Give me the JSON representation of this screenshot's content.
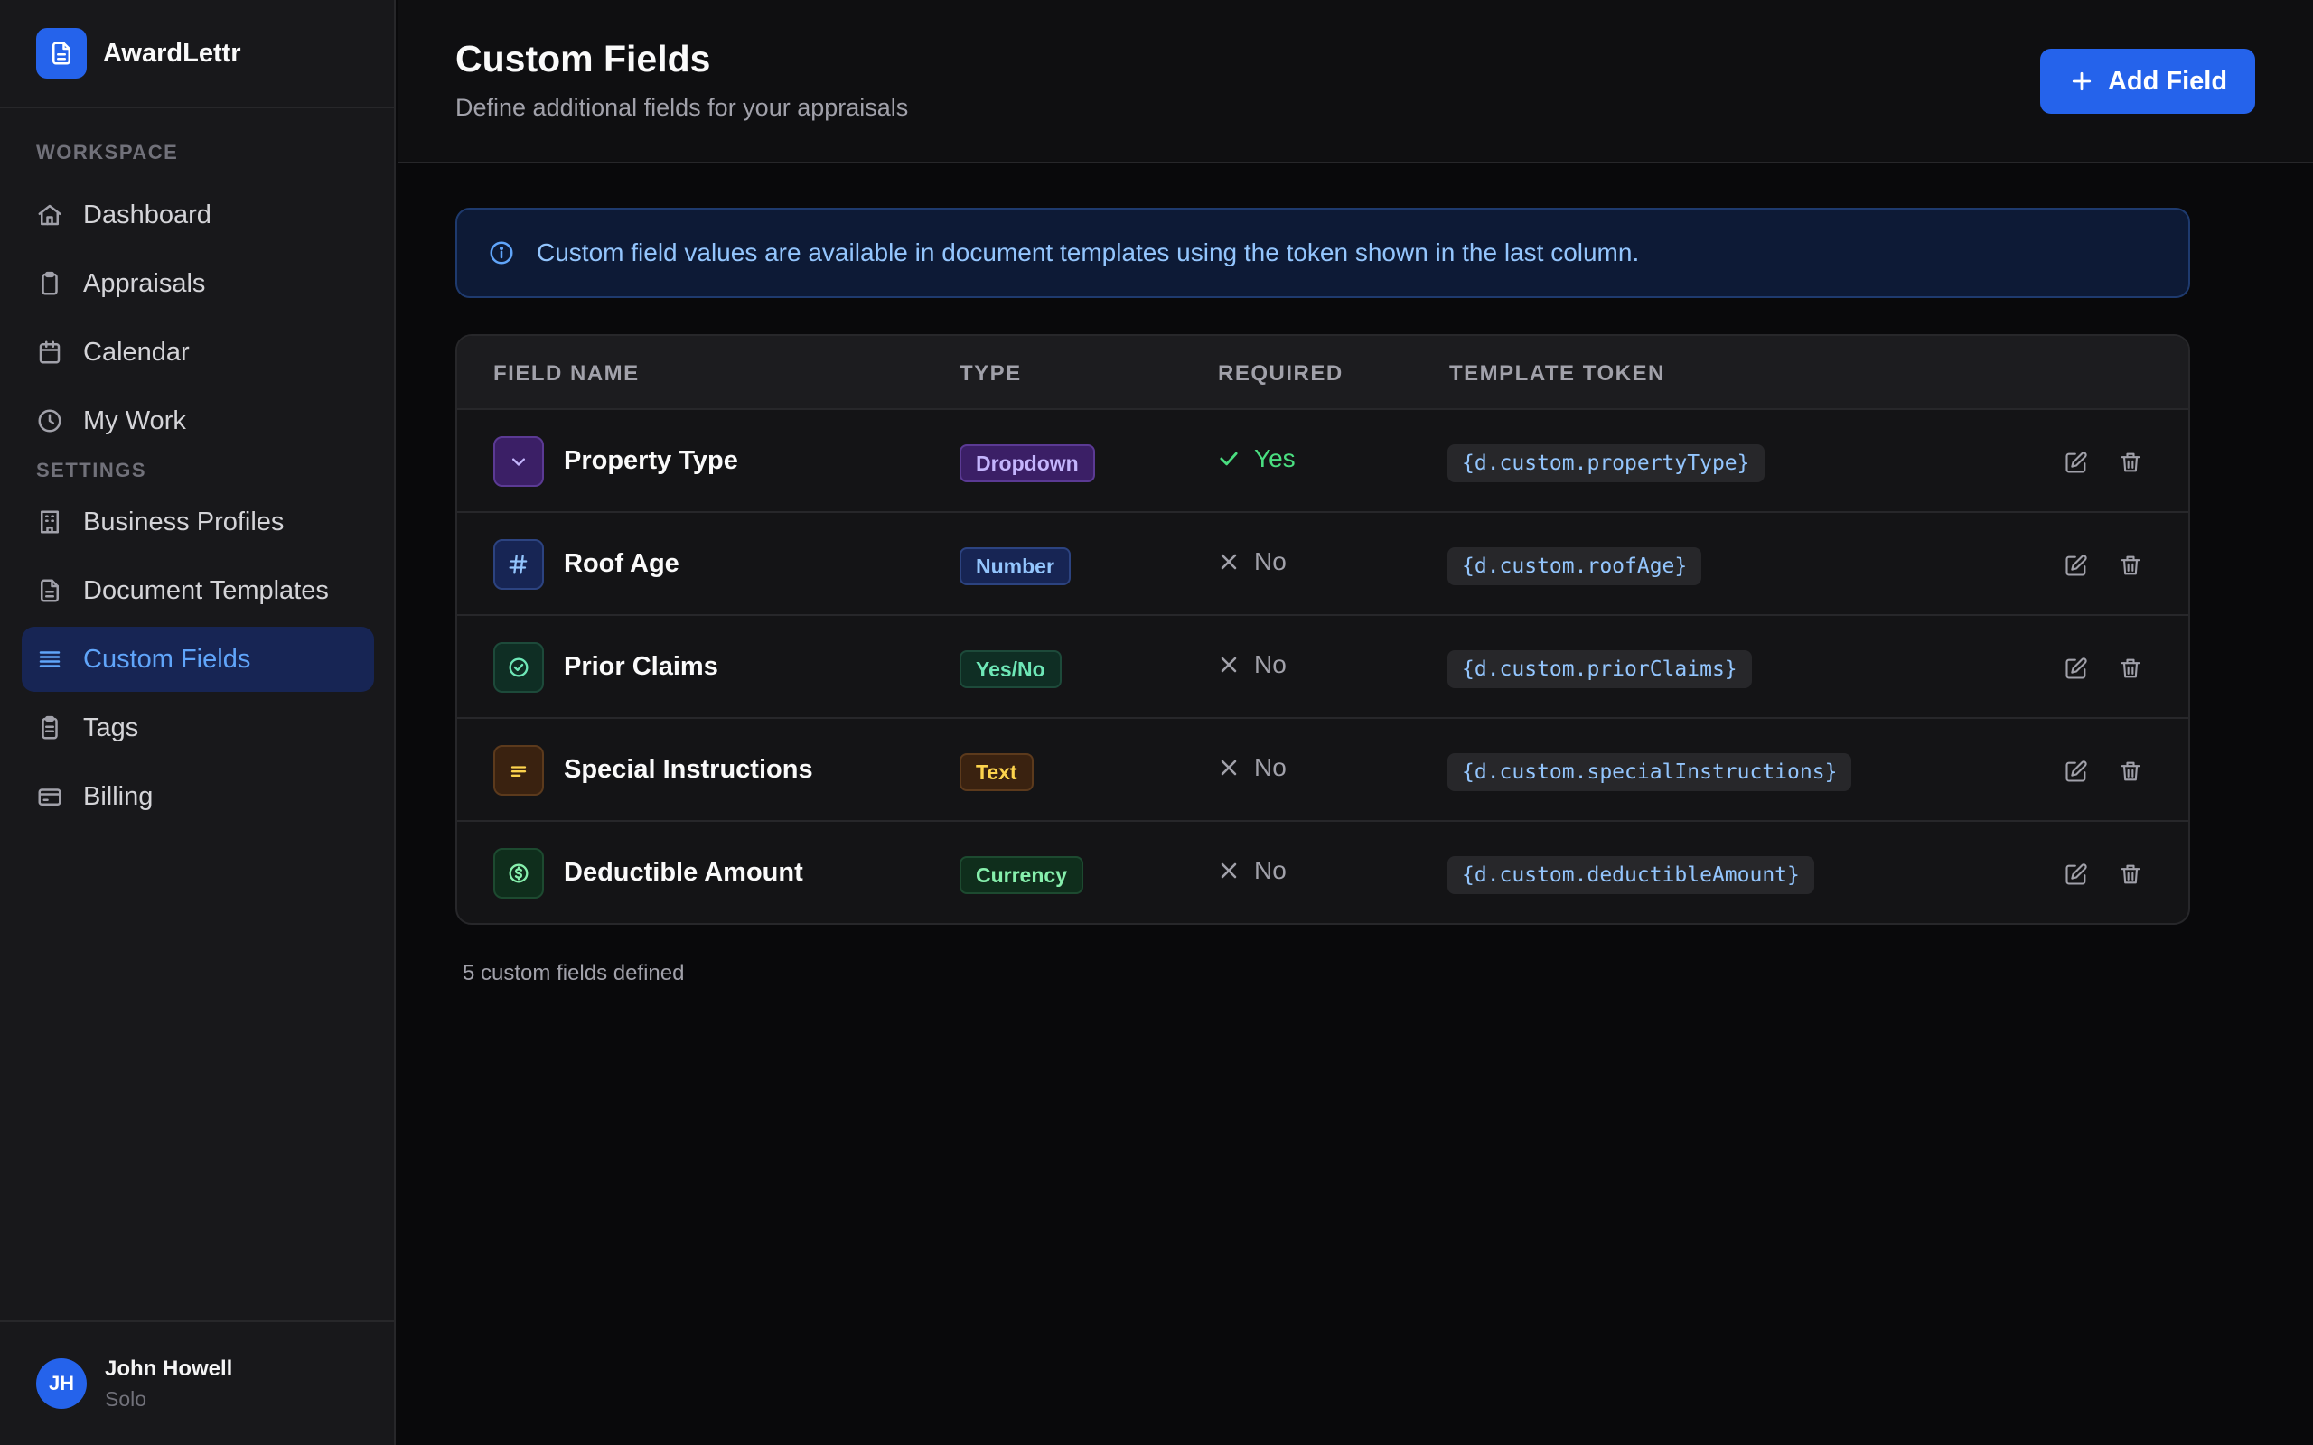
{
  "app": {
    "name": "AwardLettr"
  },
  "sidebar": {
    "sections": [
      {
        "label": "WORKSPACE"
      },
      {
        "label": "SETTINGS"
      }
    ],
    "items": [
      {
        "label": "Dashboard",
        "icon": "home-icon"
      },
      {
        "label": "Appraisals",
        "icon": "clipboard-icon"
      },
      {
        "label": "Calendar",
        "icon": "calendar-icon"
      },
      {
        "label": "My Work",
        "icon": "clock-icon"
      },
      {
        "label": "Business Profiles",
        "icon": "building-icon"
      },
      {
        "label": "Document Templates",
        "icon": "document-icon"
      },
      {
        "label": "Custom Fields",
        "icon": "list-icon",
        "active": true
      },
      {
        "label": "Tags",
        "icon": "tag-clipboard-icon"
      },
      {
        "label": "Billing",
        "icon": "credit-card-icon"
      }
    ],
    "user": {
      "initials": "JH",
      "name": "John Howell",
      "role": "Solo"
    }
  },
  "header": {
    "title": "Custom Fields",
    "subtitle": "Define additional fields for your appraisals",
    "add_label": "Add Field"
  },
  "banner": {
    "text": "Custom field values are available in document templates using the token shown in the last column."
  },
  "table": {
    "columns": [
      "FIELD NAME",
      "TYPE",
      "REQUIRED",
      "TEMPLATE TOKEN"
    ],
    "rows": [
      {
        "name": "Property Type",
        "type": "Dropdown",
        "required": "Yes",
        "token": "{d.custom.propertyType}",
        "icon": "chevron-down-icon"
      },
      {
        "name": "Roof Age",
        "type": "Number",
        "required": "No",
        "token": "{d.custom.roofAge}",
        "icon": "hash-icon"
      },
      {
        "name": "Prior Claims",
        "type": "Yes/No",
        "required": "No",
        "token": "{d.custom.priorClaims}",
        "icon": "check-circle-icon"
      },
      {
        "name": "Special Instructions",
        "type": "Text",
        "required": "No",
        "token": "{d.custom.specialInstructions}",
        "icon": "text-lines-icon"
      },
      {
        "name": "Deductible Amount",
        "type": "Currency",
        "required": "No",
        "token": "{d.custom.deductibleAmount}",
        "icon": "dollar-circle-icon"
      }
    ]
  },
  "footer": {
    "count_text": "5 custom fields defined"
  },
  "colors": {
    "accent": "#2563eb",
    "dropdown": "#c4b5fd",
    "number": "#93c5fd",
    "yesno": "#6ee7b7",
    "text": "#fcd34d",
    "currency": "#86efac"
  }
}
